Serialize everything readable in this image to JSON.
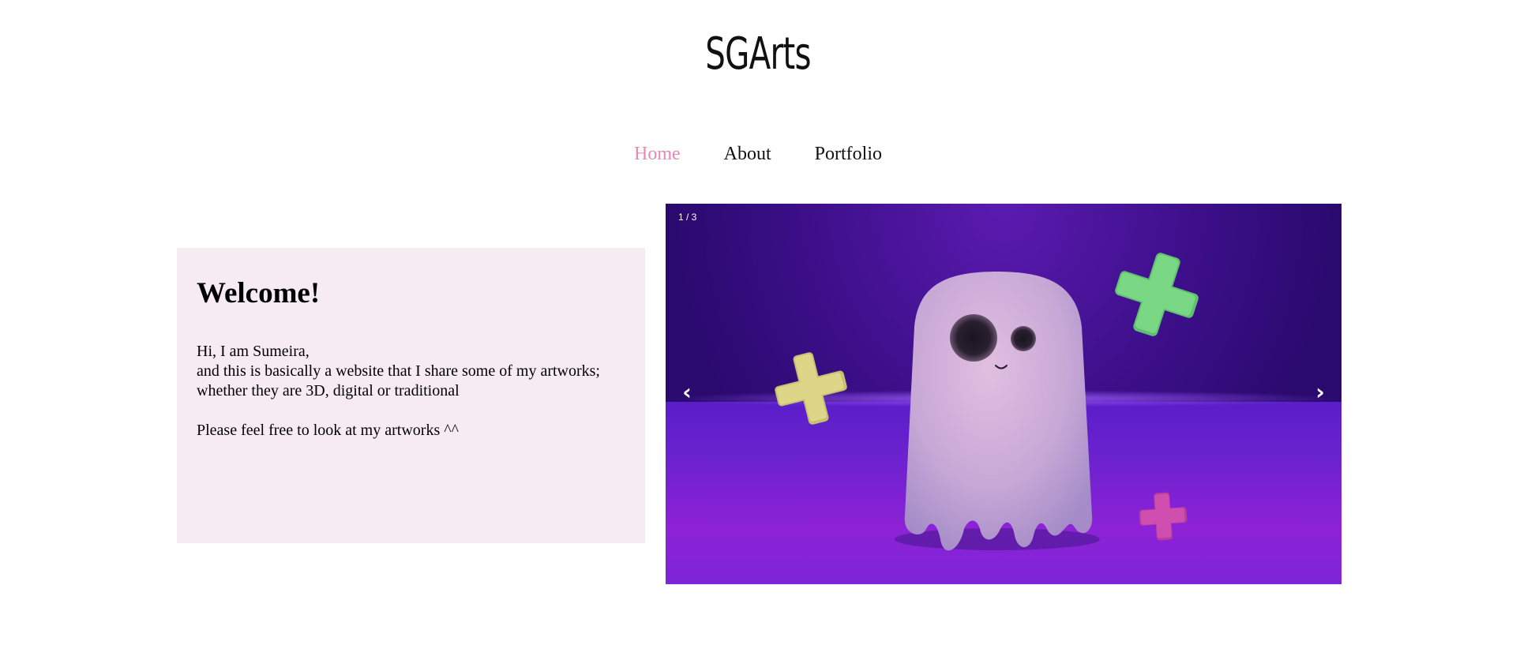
{
  "site": {
    "logo": "SGArts"
  },
  "nav": {
    "items": [
      {
        "label": "Home",
        "active": true
      },
      {
        "label": "About",
        "active": false
      },
      {
        "label": "Portfolio",
        "active": false
      }
    ]
  },
  "welcome": {
    "title": "Welcome!",
    "line1": "Hi, I am Sumeira,",
    "line2": "and this is basically a website that I share some of my artworks;",
    "line3": "whether they are 3D, digital or traditional",
    "line4": "Please feel free to look at my artworks ^^"
  },
  "slider": {
    "counter": "1 / 3",
    "prev_icon": "‹",
    "next_icon": "›",
    "current_slide": 1,
    "total_slides": 3
  },
  "colors": {
    "accent": "#e38bb5",
    "welcome_bg": "#f5ebf1",
    "slider_bg": "#3d0f8a"
  }
}
